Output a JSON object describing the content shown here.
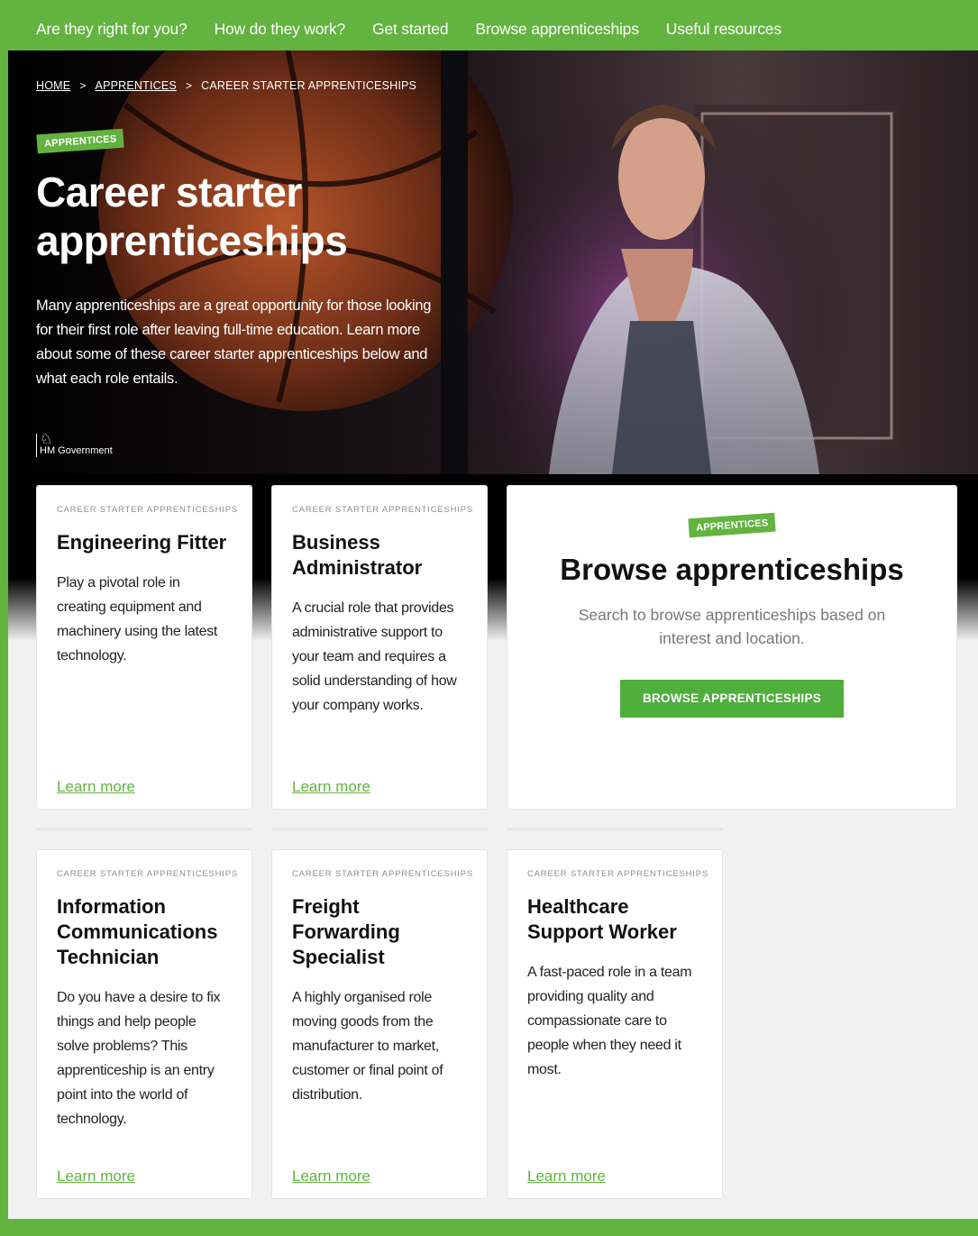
{
  "nav": {
    "items": [
      "Are they right for you?",
      "How do they work?",
      "Get started",
      "Browse apprenticeships",
      "Useful resources"
    ]
  },
  "breadcrumb": {
    "home": "HOME",
    "apprentices": "APPRENTICES",
    "current": "CAREER STARTER APPRENTICESHIPS",
    "separator": ">"
  },
  "hero": {
    "badge": "APPRENTICES",
    "title_line1": "Career starter",
    "title_line2": "apprenticeships",
    "description": "Many apprenticeships are a great opportunity for those looking for their first role after leaving full-time education. Learn more about some of these career starter apprenticeships below and what each role entails.",
    "gov_label": "HM Government"
  },
  "cards": [
    {
      "kicker": "CAREER STARTER APPRENTICESHIPS",
      "title": "Engineering Fitter",
      "description": "Play a pivotal role in creating equipment and machinery using the latest technology.",
      "link": "Learn more"
    },
    {
      "kicker": "CAREER STARTER APPRENTICESHIPS",
      "title": "Business Administrator",
      "description": "A crucial role that provides administrative support to your team and requires a solid understanding of how your company works.",
      "link": "Learn more"
    },
    {
      "kicker": "CAREER STARTER APPRENTICESHIPS",
      "title": "Information Communications Technician",
      "description": "Do you have a desire to fix things and help people solve problems? This apprenticeship is an entry point into the world of technology.",
      "link": "Learn more"
    },
    {
      "kicker": "CAREER STARTER APPRENTICESHIPS",
      "title": "Freight Forwarding Specialist",
      "description": "A highly organised role moving goods from the manufacturer to market, customer or final point of distribution.",
      "link": "Learn more"
    },
    {
      "kicker": "CAREER STARTER APPRENTICESHIPS",
      "title": "Healthcare Support Worker",
      "description": "A fast-paced role in a team providing quality and compassionate care to people when they need it most.",
      "link": "Learn more"
    }
  ],
  "browse": {
    "badge": "APPRENTICES",
    "title": "Browse apprenticeships",
    "description": "Search to browse apprenticeships based on interest and location.",
    "button": "BROWSE APPRENTICESHIPS"
  },
  "colors": {
    "brand_green": "#62b33f",
    "button_green": "#4fae3c",
    "page_bg": "#f1f1f1"
  }
}
